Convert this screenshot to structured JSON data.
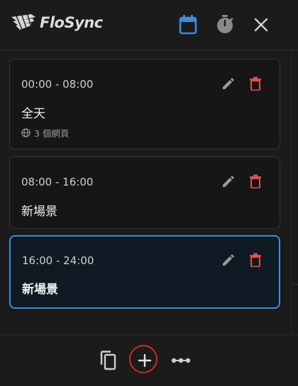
{
  "app": {
    "title": "FloSync"
  },
  "header": {
    "icons": {
      "calendar": "calendar-icon",
      "timer": "stopwatch-icon",
      "close": "close-icon"
    }
  },
  "colors": {
    "accent": "#3b8ed6",
    "danger": "#e0504a",
    "highlight_ring": "#d8252a"
  },
  "scenes": [
    {
      "time": "00:00 - 08:00",
      "name": "全天",
      "meta": "3 個網頁",
      "active": false
    },
    {
      "time": "08:00 - 16:00",
      "name": "新場景",
      "active": false
    },
    {
      "time": "16:00 - 24:00",
      "name": "新場景",
      "active": true
    }
  ],
  "footer": {
    "icons": {
      "copy": "copy-icon",
      "add": "plus-icon",
      "more": "more-icon"
    }
  }
}
